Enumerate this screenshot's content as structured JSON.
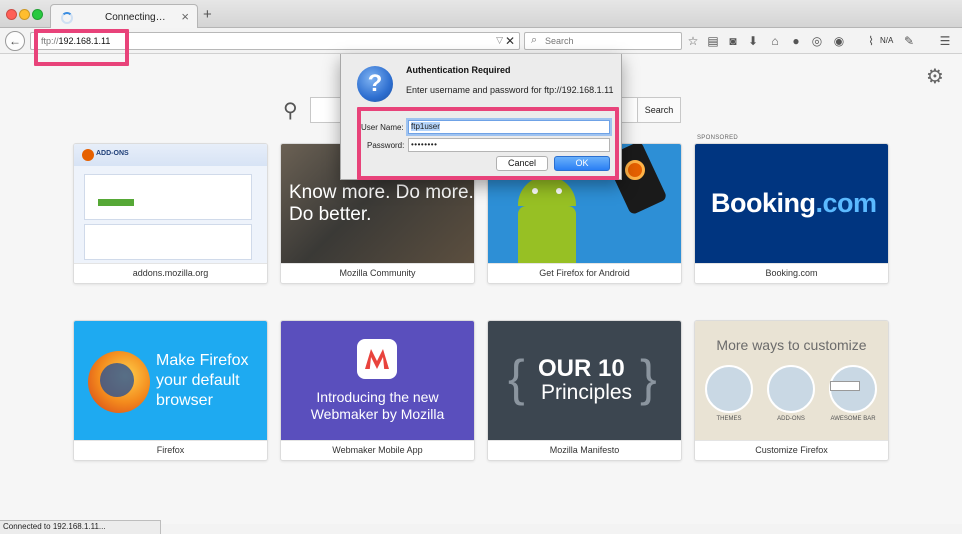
{
  "tab": {
    "title": "Connecting…",
    "close_glyph": "×",
    "new_tab_glyph": "+"
  },
  "nav": {
    "back_glyph": "←",
    "url_proto": "ftp://",
    "url_host": "192.168.1.11",
    "stop_glyph": "✕",
    "dropdown_glyph": "▽",
    "search_placeholder": "Search",
    "na_label": "N/A"
  },
  "toolbar_icons": [
    "star-icon",
    "reading-list-icon",
    "pocket-icon",
    "download-icon",
    "home-icon",
    "chat-icon",
    "sync-icon",
    "globe-icon",
    "chart-icon",
    "extension-icon",
    "menu-icon"
  ],
  "content": {
    "search_button": "Search",
    "sponsored_label": "SPONSORED"
  },
  "tiles": [
    {
      "label": "addons.mozilla.org",
      "thumb_text": "ADD-ONS"
    },
    {
      "label": "Mozilla Community",
      "thumb_text_1": "Know more. Do more.",
      "thumb_text_2": "Do better."
    },
    {
      "label": "Get Firefox for Android"
    },
    {
      "label": "Booking.com",
      "brand": "Booking",
      "brand_suffix": ".com"
    },
    {
      "label": "Firefox",
      "thumb_text_1": "Make Firefox",
      "thumb_text_2": "your default",
      "thumb_text_3": "browser"
    },
    {
      "label": "Webmaker Mobile App",
      "thumb_text_1": "Introducing the new",
      "thumb_text_2": "Webmaker by Mozilla"
    },
    {
      "label": "Mozilla Manifesto",
      "thumb_big": "OUR 10",
      "thumb_small": "Principles",
      "brace_left": "{",
      "brace_right": "}"
    },
    {
      "label": "Customize Firefox",
      "thumb_title": "More ways to customize",
      "items": [
        "THEMES",
        "ADD-ONS",
        "AWESOME BAR"
      ]
    }
  ],
  "dialog": {
    "title": "Authentication Required",
    "message": "Enter username and password for ftp://192.168.1.11",
    "icon_glyph": "?",
    "user_label": "User Name:",
    "user_value": "ftp1user",
    "pass_label": "Password:",
    "pass_value": "••••••••",
    "cancel_label": "Cancel",
    "ok_label": "OK"
  },
  "status": {
    "text": "Connected to 192.168.1.11..."
  },
  "colors": {
    "highlight": "#e8437a",
    "accent": "#2a7ef4",
    "booking": "#003580",
    "firefox_tile": "#1eaaf1",
    "webmaker": "#5a4fbd"
  }
}
